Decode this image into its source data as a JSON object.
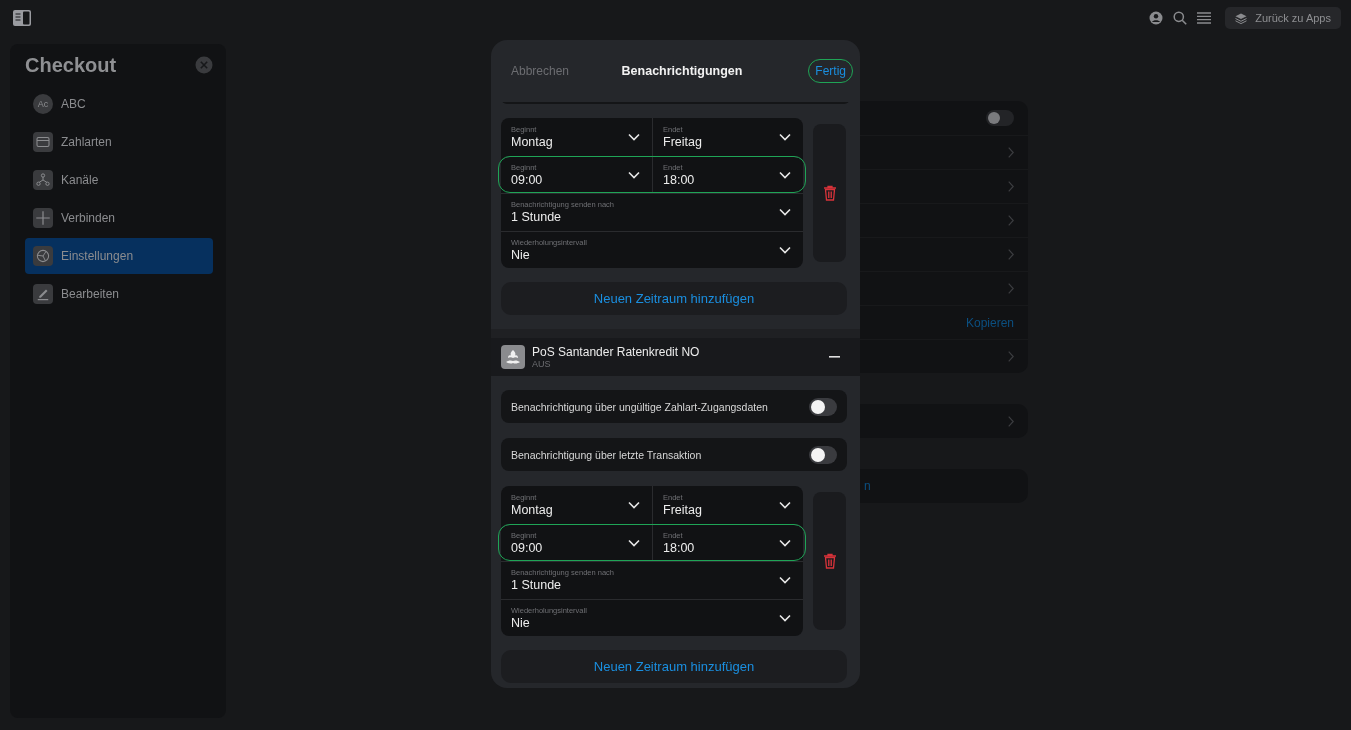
{
  "topbar": {
    "back_button": "Zurück zu Apps"
  },
  "sidebar": {
    "title": "Checkout",
    "items": [
      {
        "kind": "avatar",
        "initials": "Ac",
        "label": "ABC",
        "selected": false
      },
      {
        "kind": "card",
        "label": "Zahlarten",
        "selected": false
      },
      {
        "kind": "network",
        "label": "Kanäle",
        "selected": false
      },
      {
        "kind": "plus",
        "label": "Verbinden",
        "selected": false
      },
      {
        "kind": "gauge",
        "label": "Einstellungen",
        "selected": true
      },
      {
        "kind": "pen",
        "label": "Bearbeiten",
        "selected": false
      }
    ]
  },
  "background": {
    "cards": [
      {
        "rows": [
          {
            "kind": "toggle",
            "on": false
          },
          {
            "kind": "chevron"
          },
          {
            "kind": "chevron"
          },
          {
            "kind": "chevron"
          },
          {
            "kind": "chevron"
          },
          {
            "kind": "chevron"
          },
          {
            "kind": "link",
            "label": "Kopieren"
          },
          {
            "kind": "chevron"
          }
        ]
      },
      {
        "rows": [
          {
            "kind": "chevron"
          }
        ]
      },
      {
        "rows": [
          {
            "kind": "text",
            "label": "n"
          }
        ]
      }
    ]
  },
  "modal": {
    "cancel": "Abbrechen",
    "title": "Benachrichtigungen",
    "done": {
      "label": "Fertig",
      "highlighted": true
    },
    "sections": [
      {
        "schedule": {
          "rows": [
            {
              "kind": "pair",
              "highlighted": false,
              "fields": [
                {
                  "label": "Beginnt",
                  "value": "Montag"
                },
                {
                  "label": "Endet",
                  "value": "Freitag"
                }
              ]
            },
            {
              "kind": "pair",
              "highlighted": true,
              "fields": [
                {
                  "label": "Beginnt",
                  "value": "09:00"
                },
                {
                  "label": "Endet",
                  "value": "18:00"
                }
              ]
            },
            {
              "kind": "single",
              "highlighted": false,
              "fields": [
                {
                  "label": "Benachrichtigung senden nach",
                  "value": "1 Stunde"
                }
              ]
            },
            {
              "kind": "single",
              "highlighted": false,
              "fields": [
                {
                  "label": "Wiederholungsintervall",
                  "value": "Nie"
                }
              ]
            }
          ]
        },
        "add_button": "Neuen Zeitraum hinzufügen"
      },
      {
        "header": {
          "title": "PoS Santander Ratenkredit NO",
          "subtitle": "AUS"
        },
        "toggles": [
          {
            "label": "Benachrichtigung über ungültige Zahlart-Zugangsdaten",
            "on": false
          },
          {
            "label": "Benachrichtigung über letzte Transaktion",
            "on": false
          }
        ],
        "schedule": {
          "rows": [
            {
              "kind": "pair",
              "highlighted": false,
              "fields": [
                {
                  "label": "Beginnt",
                  "value": "Montag"
                },
                {
                  "label": "Endet",
                  "value": "Freitag"
                }
              ]
            },
            {
              "kind": "pair",
              "highlighted": true,
              "fields": [
                {
                  "label": "Beginnt",
                  "value": "09:00"
                },
                {
                  "label": "Endet",
                  "value": "18:00"
                }
              ]
            },
            {
              "kind": "single",
              "highlighted": false,
              "fields": [
                {
                  "label": "Benachrichtigung senden nach",
                  "value": "1 Stunde"
                }
              ]
            },
            {
              "kind": "single",
              "highlighted": false,
              "fields": [
                {
                  "label": "Wiederholungsintervall",
                  "value": "Nie"
                }
              ]
            }
          ]
        },
        "add_button": "Neuen Zeitraum hinzufügen"
      }
    ]
  }
}
